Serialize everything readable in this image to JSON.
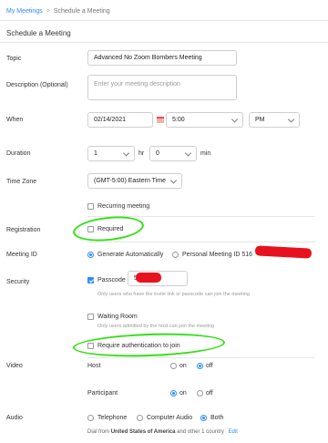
{
  "breadcrumb": {
    "link": "My Meetings",
    "separator": ">",
    "current": "Schedule a Meeting"
  },
  "page_title": "Schedule a Meeting",
  "labels": {
    "topic": "Topic",
    "description": "Description (Optional)",
    "when": "When",
    "duration": "Duration",
    "time_zone": "Time Zone",
    "registration": "Registration",
    "meeting_id": "Meeting ID",
    "security": "Security",
    "video": "Video",
    "audio": "Audio"
  },
  "topic": {
    "value": "Advanced No Zoom Bombers Meeting"
  },
  "description": {
    "placeholder": "Enter your meeting description"
  },
  "when": {
    "date": "02/14/2021",
    "time": "5:00",
    "ampm": "PM"
  },
  "duration": {
    "hours": "1",
    "hr_label": "hr",
    "minutes": "0",
    "min_label": "min"
  },
  "time_zone": {
    "value": "(GMT-5:00) Eastern Time"
  },
  "recurring": {
    "label": "Recurring meeting",
    "checked": false
  },
  "registration": {
    "label": "Required",
    "checked": false
  },
  "meeting_id": {
    "generate_label": "Generate Automatically",
    "personal_label": "Personal Meeting ID 516",
    "selected": "generate"
  },
  "security": {
    "passcode_label": "Passcode",
    "passcode_value": "5",
    "passcode_checked": true,
    "passcode_note": "Only users who have the invite link or passcode can join the meeting",
    "waiting_room_label": "Waiting Room",
    "waiting_room_checked": false,
    "waiting_room_note": "Only users admitted by the host can join the meeting",
    "auth_label": "Require authentication to join",
    "auth_checked": false
  },
  "video": {
    "host_label": "Host",
    "host_on": "on",
    "host_off": "off",
    "host_selected": "off",
    "participant_label": "Participant",
    "part_on": "on",
    "part_off": "off",
    "part_selected": "on"
  },
  "audio": {
    "telephone": "Telephone",
    "computer": "Computer Audio",
    "both": "Both",
    "selected": "both",
    "dial_prefix": "Dial from",
    "dial_country": "United States of America",
    "dial_suffix": "and other 1 country",
    "edit_label": "Edit"
  },
  "colors": {
    "accent": "#2d8cff",
    "highlight": "#33e014",
    "redaction": "#e8121e"
  }
}
